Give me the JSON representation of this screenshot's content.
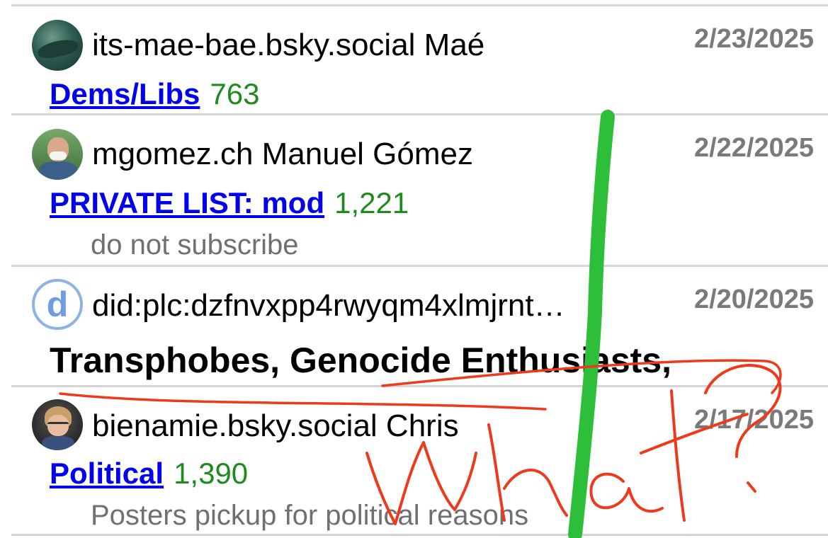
{
  "entries": [
    {
      "handle": "its-mae-bae.bsky.social Maé",
      "date": "2/23/2025",
      "list_name": "Dems/Libs",
      "count": "763",
      "avatar": "whale-photo-avatar"
    },
    {
      "handle": "mgomez.ch Manuel Gómez",
      "date": "2/22/2025",
      "list_name": "PRIVATE LIST: mod",
      "count": "1,221",
      "description": "do not subscribe",
      "avatar": "person-photo-avatar"
    },
    {
      "handle": "did:plc:dzfnvxpp4rwyqm4xlmjrnt…",
      "date": "2/20/2025",
      "title": "Transphobes, Genocide Enthusiasts,",
      "avatar": "default-d-avatar",
      "avatar_letter": "d"
    },
    {
      "handle": "bienamie.bsky.social Chris",
      "date": "2/17/2025",
      "list_name": "Political",
      "count": "1,390",
      "description": "Posters pickup for political reasons",
      "avatar": "cartoon-person-avatar"
    }
  ],
  "annotation": {
    "handwritten_text": "What?",
    "colors": {
      "red_ink": "#ee3a1c",
      "green_ink": "#2dbe3a"
    }
  },
  "colors": {
    "link": "#0000ee",
    "count": "#1f8a1f",
    "muted": "#707070",
    "separator": "#d4d4d4"
  }
}
